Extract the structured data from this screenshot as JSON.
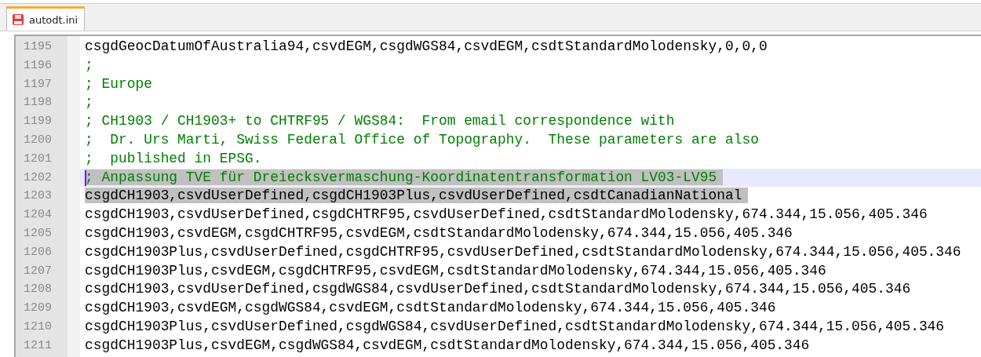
{
  "tabs": [
    {
      "label": "autodt.ini",
      "selected": true
    }
  ],
  "editor": {
    "lines": [
      {
        "number": "1195",
        "kind": "code",
        "text": "csgdGeocDatumOfAustralia94,csvdEGM,csgdWGS84,csvdEGM,csdtStandardMolodensky,0,0,0",
        "selected": false,
        "current": false
      },
      {
        "number": "1196",
        "kind": "comment",
        "text": ";",
        "selected": false,
        "current": false
      },
      {
        "number": "1197",
        "kind": "comment",
        "text": "; Europe",
        "selected": false,
        "current": false
      },
      {
        "number": "1198",
        "kind": "comment",
        "text": ";",
        "selected": false,
        "current": false
      },
      {
        "number": "1199",
        "kind": "comment",
        "text": "; CH1903 / CH1903+ to CHTRF95 / WGS84:  From email correspondence with",
        "selected": false,
        "current": false
      },
      {
        "number": "1200",
        "kind": "comment",
        "text": ";  Dr. Urs Marti, Swiss Federal Office of Topography.  These parameters are also",
        "selected": false,
        "current": false
      },
      {
        "number": "1201",
        "kind": "comment",
        "text": ";  published in EPSG.",
        "selected": false,
        "current": false
      },
      {
        "number": "1202",
        "kind": "comment",
        "text": "; Anpassung TVE für Dreiecksvermaschung-Koordinatentransformation LV03-LV95",
        "selected": true,
        "current": true
      },
      {
        "number": "1203",
        "kind": "code",
        "text": "csgdCH1903,csvdUserDefined,csgdCH1903Plus,csvdUserDefined,csdtCanadianNational",
        "selected": true,
        "current": false
      },
      {
        "number": "1204",
        "kind": "code",
        "text": "csgdCH1903,csvdUserDefined,csgdCHTRF95,csvdUserDefined,csdtStandardMolodensky,674.344,15.056,405.346",
        "selected": false,
        "current": false
      },
      {
        "number": "1205",
        "kind": "code",
        "text": "csgdCH1903,csvdEGM,csgdCHTRF95,csvdEGM,csdtStandardMolodensky,674.344,15.056,405.346",
        "selected": false,
        "current": false
      },
      {
        "number": "1206",
        "kind": "code",
        "text": "csgdCH1903Plus,csvdUserDefined,csgdCHTRF95,csvdUserDefined,csdtStandardMolodensky,674.344,15.056,405.346",
        "selected": false,
        "current": false
      },
      {
        "number": "1207",
        "kind": "code",
        "text": "csgdCH1903Plus,csvdEGM,csgdCHTRF95,csvdEGM,csdtStandardMolodensky,674.344,15.056,405.346",
        "selected": false,
        "current": false
      },
      {
        "number": "1208",
        "kind": "code",
        "text": "csgdCH1903,csvdUserDefined,csgdWGS84,csvdUserDefined,csdtStandardMolodensky,674.344,15.056,405.346",
        "selected": false,
        "current": false
      },
      {
        "number": "1209",
        "kind": "code",
        "text": "csgdCH1903,csvdEGM,csgdWGS84,csvdEGM,csdtStandardMolodensky,674.344,15.056,405.346",
        "selected": false,
        "current": false
      },
      {
        "number": "1210",
        "kind": "code",
        "text": "csgdCH1903Plus,csvdUserDefined,csgdWGS84,csvdUserDefined,csdtStandardMolodensky,674.344,15.056,405.346",
        "selected": false,
        "current": false
      },
      {
        "number": "1211",
        "kind": "code",
        "text": "csgdCH1903Plus,csvdEGM,csgdWGS84,csvdEGM,csdtStandardMolodensky,674.344,15.056,405.346",
        "selected": false,
        "current": false
      }
    ]
  }
}
